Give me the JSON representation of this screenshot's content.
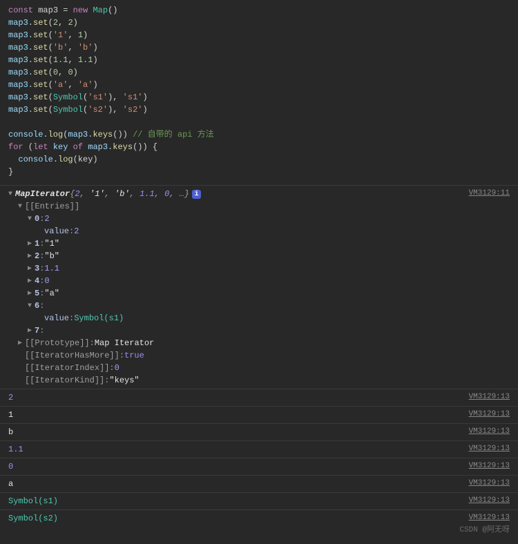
{
  "code": {
    "l1": {
      "kw1": "const",
      "v": " map3 ",
      "op": "= ",
      "kw2": "new",
      "cls": " Map",
      "tail": "()"
    },
    "l2": {
      "obj": "map3.",
      "fn": "set",
      "open": "(",
      "a": "2",
      "sep": ", ",
      "b": "2",
      "close": ")"
    },
    "l3": {
      "obj": "map3.",
      "fn": "set",
      "open": "(",
      "a": "'1'",
      "sep": ", ",
      "b": "1",
      "close": ")"
    },
    "l4": {
      "obj": "map3.",
      "fn": "set",
      "open": "(",
      "a": "'b'",
      "sep": ", ",
      "b": "'b'",
      "close": ")"
    },
    "l5": {
      "obj": "map3.",
      "fn": "set",
      "open": "(",
      "a": "1.1",
      "sep": ", ",
      "b": "1.1",
      "close": ")"
    },
    "l6": {
      "obj": "map3.",
      "fn": "set",
      "open": "(",
      "a": "0",
      "sep": ", ",
      "b": "0",
      "close": ")"
    },
    "l7": {
      "obj": "map3.",
      "fn": "set",
      "open": "(",
      "a": "'a'",
      "sep": ", ",
      "b": "'a'",
      "close": ")"
    },
    "l8": {
      "obj": "map3.",
      "fn": "set",
      "open": "(",
      "sym": "Symbol",
      "sarg": "'s1'",
      "sep": ", ",
      "b": "'s1'",
      "close": ")"
    },
    "l9": {
      "obj": "map3.",
      "fn": "set",
      "open": "(",
      "sym": "Symbol",
      "sarg": "'s2'",
      "sep": ", ",
      "b": "'s2'",
      "close": ")"
    },
    "l10": {
      "obj": "console.",
      "fn": "log",
      "open": "(",
      "v": "map3.",
      "fn2": "keys",
      "close": "()) ",
      "cm": "// 自带的 api 方法"
    },
    "l11": {
      "kw1": "for",
      "p1": " (",
      "kw2": "let",
      "v": " key ",
      "kw3": "of",
      "obj": " map3.",
      "fn": "keys",
      "p2": "()) {"
    },
    "l12": {
      "indent": "  ",
      "obj": "console.",
      "fn": "log",
      "p": "(key)"
    },
    "l13": {
      "brace": "}"
    }
  },
  "out": {
    "header": {
      "cls": "MapIterator ",
      "brace1": "{",
      "preview": [
        {
          "t": "num",
          "v": "2"
        },
        {
          "t": "sep",
          "v": ", "
        },
        {
          "t": "str",
          "v": "'1'"
        },
        {
          "t": "sep",
          "v": ", "
        },
        {
          "t": "str",
          "v": "'b'"
        },
        {
          "t": "sep",
          "v": ", "
        },
        {
          "t": "num",
          "v": "1.1"
        },
        {
          "t": "sep",
          "v": ", "
        },
        {
          "t": "num",
          "v": "0"
        },
        {
          "t": "sep",
          "v": ", …"
        }
      ],
      "brace2": "}",
      "src": "VM3129:11"
    },
    "entries_label": "[[Entries]]",
    "entries": [
      {
        "idx": "0",
        "val": "2",
        "expanded": true,
        "valueLabel": "value",
        "valueShown": "2",
        "valType": "num"
      },
      {
        "idx": "1",
        "val": "\"1\"",
        "valType": "str"
      },
      {
        "idx": "2",
        "val": "\"b\"",
        "valType": "str"
      },
      {
        "idx": "3",
        "val": "1.1",
        "valType": "num"
      },
      {
        "idx": "4",
        "val": "0",
        "valType": "num"
      },
      {
        "idx": "5",
        "val": "\"a\"",
        "valType": "str"
      },
      {
        "idx": "6",
        "val": "",
        "expanded": true,
        "valueLabel": "value",
        "valueShown": "Symbol(s1)",
        "valType": "sym"
      },
      {
        "idx": "7",
        "val": ""
      }
    ],
    "proto": {
      "label": "[[Prototype]]",
      "val": "Map Iterator"
    },
    "hasMore": {
      "label": "[[IteratorHasMore]]",
      "val": "true"
    },
    "idx": {
      "label": "[[IteratorIndex]]",
      "val": "0"
    },
    "kind": {
      "label": "[[IteratorKind]]",
      "val": "\"keys\""
    },
    "logs": [
      {
        "v": "2",
        "type": "num",
        "src": "VM3129:13"
      },
      {
        "v": "1",
        "type": "str",
        "src": "VM3129:13"
      },
      {
        "v": "b",
        "type": "str",
        "src": "VM3129:13"
      },
      {
        "v": "1.1",
        "type": "num",
        "src": "VM3129:13"
      },
      {
        "v": "0",
        "type": "num",
        "src": "VM3129:13"
      },
      {
        "v": "a",
        "type": "str",
        "src": "VM3129:13"
      },
      {
        "v": "Symbol(s1)",
        "type": "sym",
        "src": "VM3129:13"
      },
      {
        "v": "Symbol(s2)",
        "type": "sym",
        "src": "VM3129:13"
      }
    ]
  },
  "watermark": "CSDN @阿无呀"
}
